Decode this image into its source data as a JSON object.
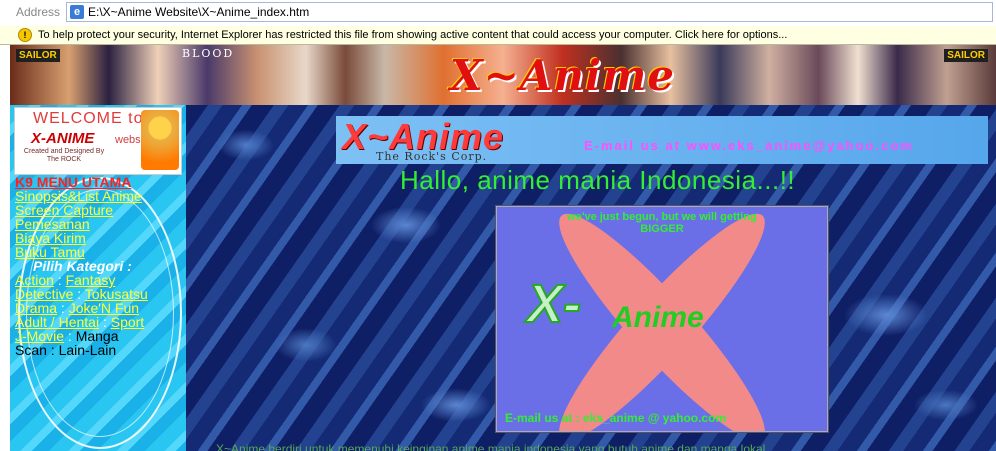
{
  "address_bar": {
    "label": "Address",
    "url": "E:\\X~Anime Website\\X~Anime_index.htm"
  },
  "info_bar": {
    "icon": "shield-warning-icon",
    "message": "To help protect your security, Internet Explorer has restricted this file from showing active content that could access your computer. Click here for options..."
  },
  "banner": {
    "title": "X~Anime",
    "logo_left": "SAILOR",
    "logo_mid": "BLOOD",
    "logo_right": "SAILOR"
  },
  "welcome_box": {
    "line1": "WELCOME to",
    "line2": "X-ANIME",
    "line3": "website",
    "credit": "Created and Designed By The ROCK"
  },
  "menu": {
    "header": "K9 MENU UTAMA",
    "links": [
      "Sinopsis&List Anime",
      "Screen Capture",
      "Pemesanan",
      "Biaya Kirim",
      "Buku Tamu"
    ],
    "category_title": "Pilih Kategori :",
    "categories": {
      "action": "Action",
      "fantasy": "Fantasy",
      "detective": "Detective",
      "tokusatsu": "Tokusatsu",
      "drama": "Drama",
      "joke": "Joke'N Fun",
      "adult": "Adult / Hentai",
      "sport": "Sport",
      "jmovie": "J-Movie",
      "manga": "Manga",
      "scan": "Scan",
      "lain": "Lain-Lain"
    }
  },
  "header": {
    "logo": "X~Anime",
    "tagline": "The Rock's Corp.",
    "email_text": "E-mail us at www.eks_anime@yahoo.com"
  },
  "greeting": "Hallo, anime mania Indonesia...!!",
  "poster": {
    "top_text_1": "we've just begun, but we will getting",
    "top_text_2": "BIGGER",
    "big_x": "X-",
    "big_anime": "Anime",
    "bottom_text": "E-mail us at : eks_anime @ yahoo.com"
  },
  "footer_text": "X~Anime berdiri untuk memenuhi keinginan anime mania indonesia yang butuh anime dan manga lokal"
}
